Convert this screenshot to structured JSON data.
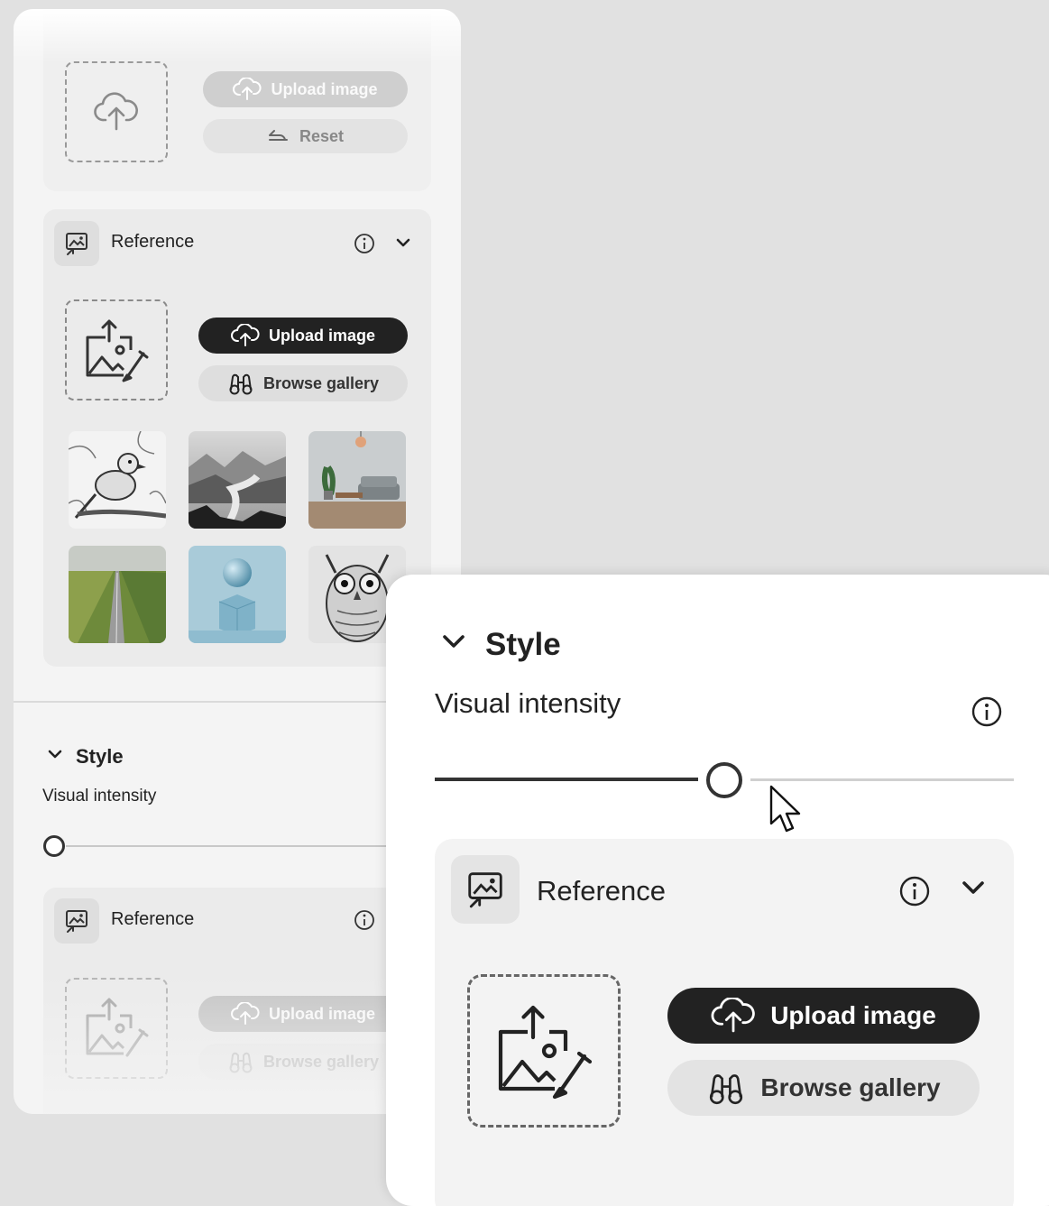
{
  "background_panel": {
    "object_section": {
      "upload_label": "Upload image",
      "reset_label": "Reset"
    },
    "reference_section": {
      "title": "Reference",
      "upload_label": "Upload image",
      "browse_label": "Browse gallery",
      "thumbnails": [
        {
          "name": "bird-sketch-thumbnail"
        },
        {
          "name": "misty-mountains-thumbnail"
        },
        {
          "name": "living-room-thumbnail"
        },
        {
          "name": "road-field-thumbnail"
        },
        {
          "name": "sphere-cube-thumbnail"
        },
        {
          "name": "owl-sketch-thumbnail"
        }
      ]
    },
    "style_section": {
      "title": "Style",
      "visual_intensity_label": "Visual intensity",
      "visual_intensity_value": 0,
      "reference": {
        "title": "Reference",
        "upload_label": "Upload image",
        "browse_label": "Browse gallery"
      }
    }
  },
  "zoom_panel": {
    "style_title": "Style",
    "visual_intensity_label": "Visual intensity",
    "visual_intensity_value": 0.5,
    "reference": {
      "title": "Reference",
      "upload_label": "Upload image",
      "browse_label": "Browse gallery"
    }
  },
  "colors": {
    "dark_button": "#222222",
    "light_button": "#dedede",
    "panel_bg": "#f4f4f4",
    "card_bg": "#ebebeb",
    "canvas_bg": "#e1e1e1"
  }
}
